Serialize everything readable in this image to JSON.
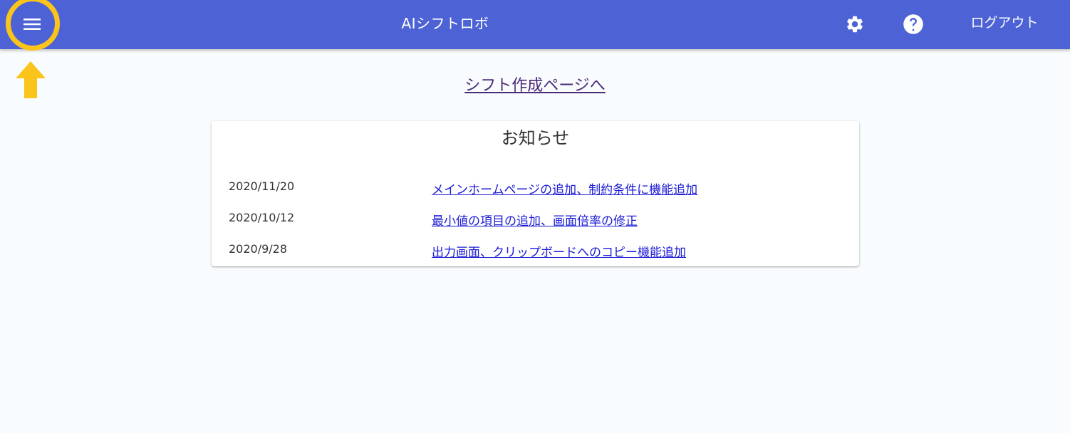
{
  "app_bar": {
    "title": "AIシフトロボ",
    "menu_icon": "hamburger-menu-icon",
    "settings_icon": "gear-icon",
    "help_icon": "question-circle-icon",
    "logout_label": "ログアウト"
  },
  "annotation": {
    "highlight_color": "#fbc41a",
    "arrow_icon": "arrow-up-icon"
  },
  "main": {
    "create_shift_link": "シフト作成ページへ"
  },
  "news": {
    "title": "お知らせ",
    "items": [
      {
        "date": "2020/11/20",
        "text": "メインホームページの追加、制約条件に機能追加"
      },
      {
        "date": "2020/10/12",
        "text": "最小値の項目の追加、画面倍率の修正"
      },
      {
        "date": "2020/9/28",
        "text": "出力画面、クリップボードへのコピー機能追加"
      }
    ]
  },
  "colors": {
    "app_bar": "#4d63d5",
    "background": "#f9fcfe",
    "link": "#1a1ad6",
    "visited_link": "#4b2a78"
  }
}
